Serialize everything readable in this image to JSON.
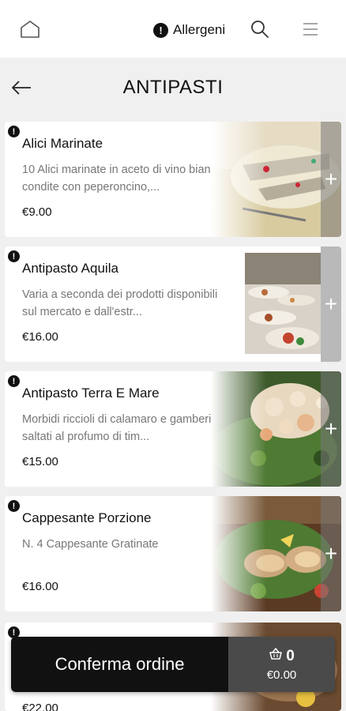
{
  "topbar": {
    "home_icon": "home-icon",
    "allergen_label": "Allergeni",
    "allergen_icon": "exclamation-circle-icon",
    "search_icon": "search-icon",
    "menu_icon": "hamburger-menu-icon"
  },
  "header": {
    "back_icon": "arrow-left-icon",
    "title": "ANTIPASTI"
  },
  "items": [
    {
      "name": "Alici Marinate",
      "description": "10 Alici marinate in aceto di vino bianco condite con peperoncino,...",
      "price": "€9.00",
      "add_label": "+"
    },
    {
      "name": "Antipasto Aquila",
      "description": "Varia a seconda dei prodotti disponibili sul mercato e dall'estr...",
      "price": "€16.00",
      "add_label": "+"
    },
    {
      "name": "Antipasto Terra E Mare",
      "description": "Morbidi riccioli di calamaro e gamberi saltati al profumo di tim...",
      "price": "€15.00",
      "add_label": "+"
    },
    {
      "name": "Cappesante Porzione",
      "description": "N. 4 Cappesante Gratinate",
      "price": "€16.00",
      "add_label": "+"
    }
  ],
  "peek_item": {
    "price": "€22.00"
  },
  "cart": {
    "confirm_label": "Conferma ordine",
    "count": "0",
    "total": "€0.00",
    "basket_icon": "basket-icon"
  },
  "colors": {
    "primary": "#111111",
    "cart_summary_bg": "#4a4a4a",
    "background": "#f0f0f0"
  }
}
